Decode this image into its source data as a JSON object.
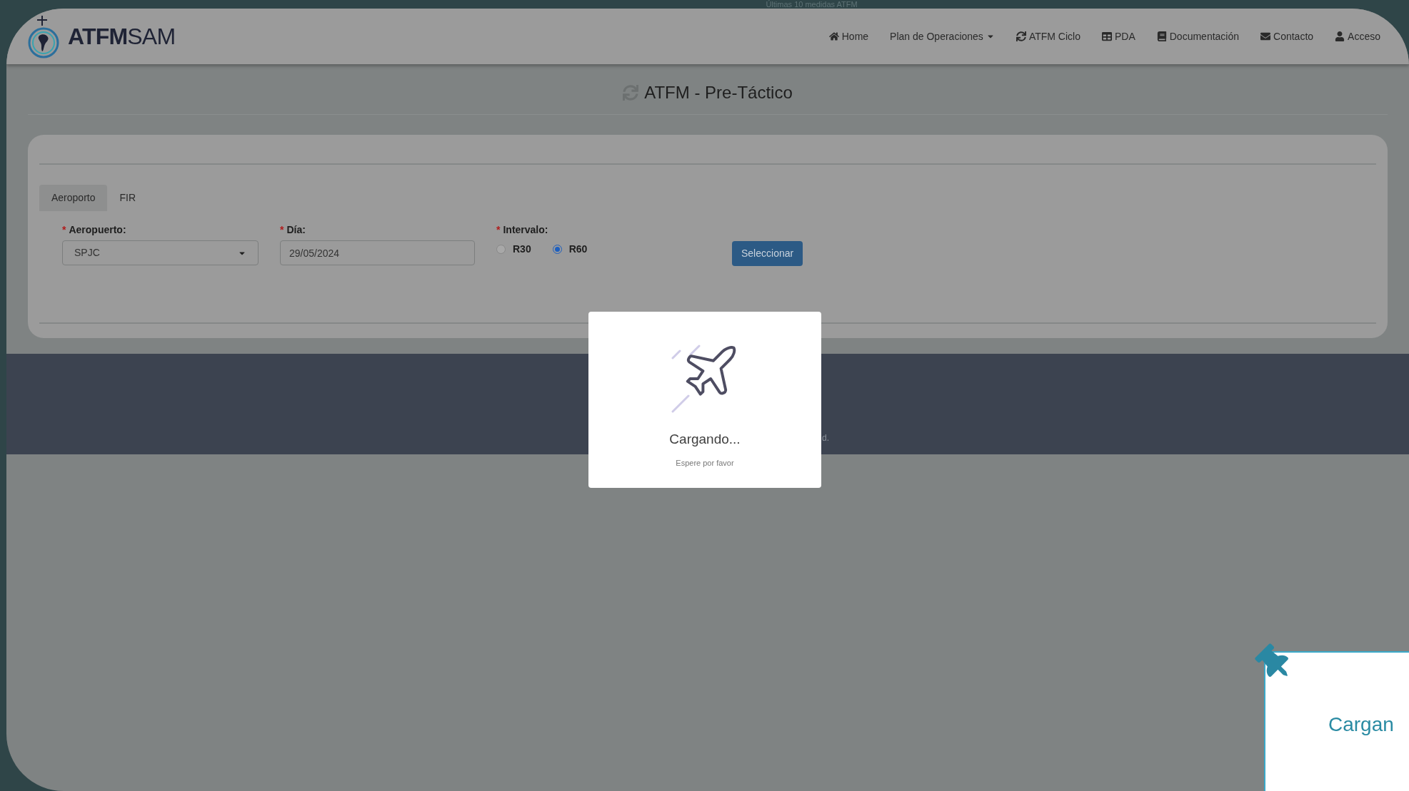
{
  "background_heading": "Últimas 10 medidas ATFM",
  "logo": {
    "text": "**ATFM**SAM"
  },
  "nav": [
    {
      "label": "Home"
    },
    {
      "label": "Plan de Operaciones",
      "dropdown": true
    },
    {
      "label": "ATFM Ciclo"
    },
    {
      "label": "PDA"
    },
    {
      "label": "Documentación"
    },
    {
      "label": "Contacto"
    },
    {
      "label": "Acceso"
    }
  ],
  "page_title": "ATFM - Pre-Táctico",
  "tabs": [
    {
      "label": "Aeroporto",
      "selected": true
    },
    {
      "label": "FIR",
      "selected": false
    }
  ],
  "form": {
    "airport": {
      "label": "Aeropuerto:",
      "value": "SPJC"
    },
    "day": {
      "label": "Día:",
      "value": "29/05/2024"
    },
    "interval": {
      "label": "Intervalo:",
      "options": [
        {
          "label": "R30",
          "selected": false
        },
        {
          "label": "R60",
          "selected": true
        }
      ]
    },
    "required_mark": "*",
    "submit": "Seleccionar"
  },
  "footer_text": "d.",
  "loading_modal": {
    "title": "Cargando...",
    "subtitle": "Espere por favor"
  },
  "side_toast": {
    "text": "Cargan"
  }
}
